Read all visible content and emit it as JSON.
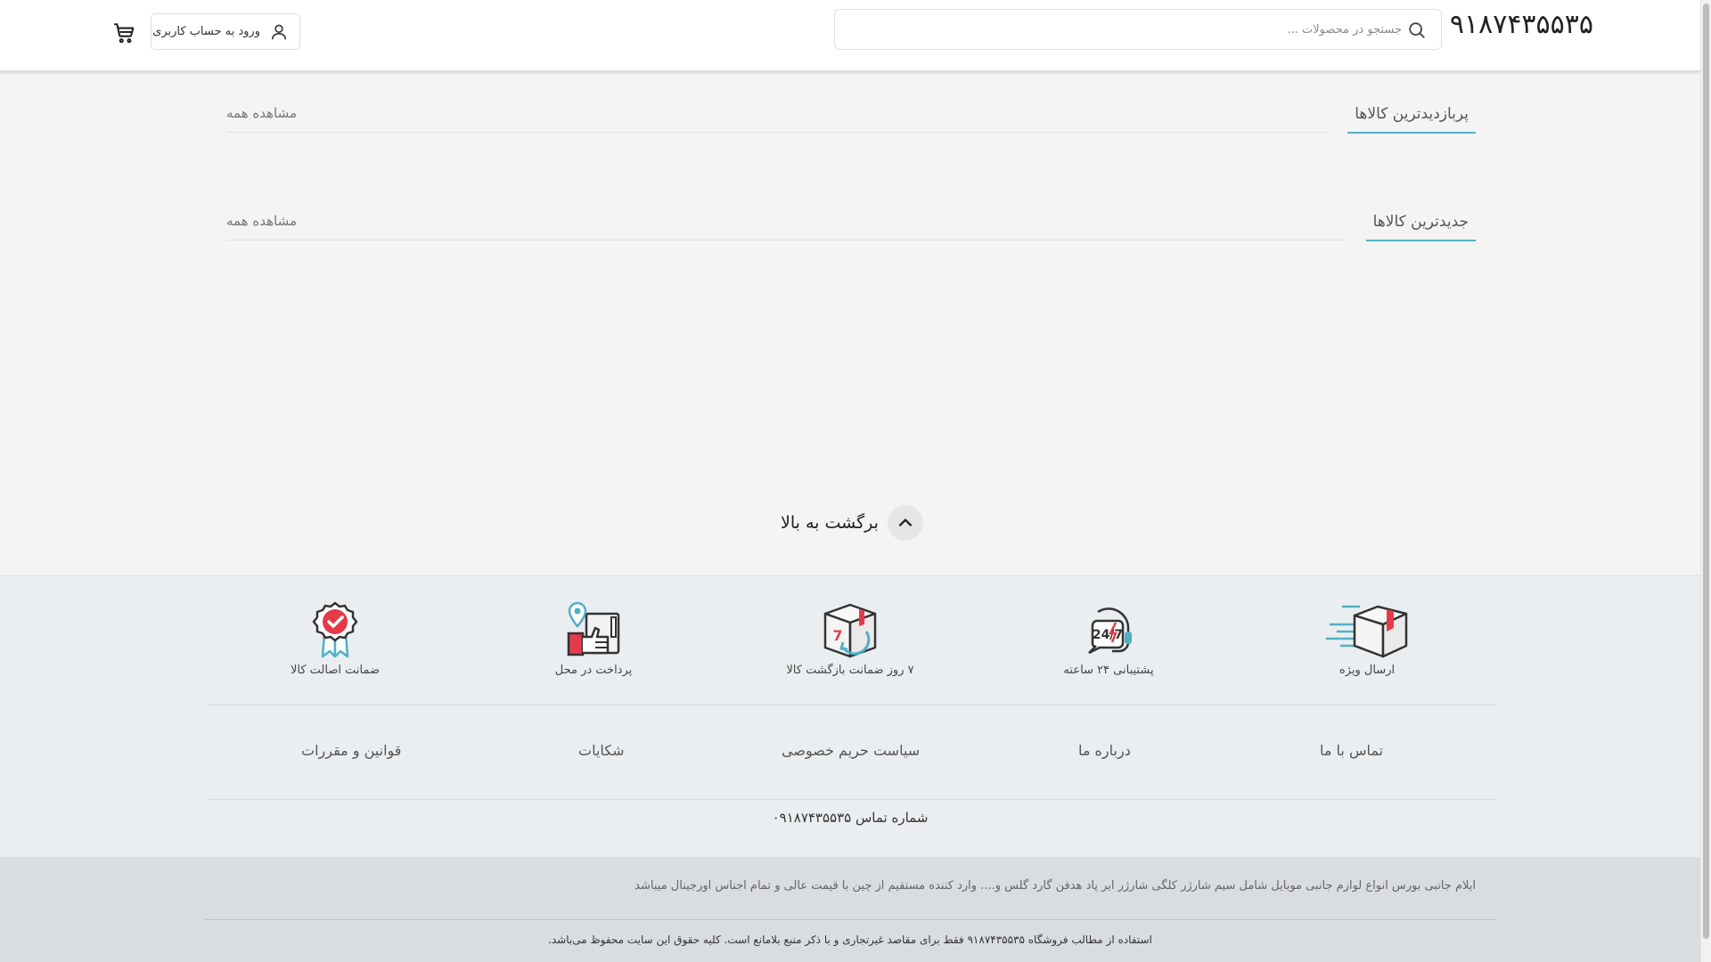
{
  "header": {
    "logo": "۹۱۸۷۴۳۵۵۳۵",
    "search_placeholder": "جستجو در محصولات ...",
    "login_label": "ورود به حساب کاربری"
  },
  "sections": [
    {
      "title": "پربازدیدترین کالاها",
      "see_all": "مشاهده همه"
    },
    {
      "title": "جدیدترین کالاها",
      "see_all": "مشاهده همه"
    }
  ],
  "back_to_top": "برگشت به بالا",
  "features": [
    {
      "label": "ارسال ویژه",
      "icon": "fast-delivery-box-icon"
    },
    {
      "label": "پشتیبانی ۲۴ ساعته",
      "icon": "support-24-7-icon"
    },
    {
      "label": "۷ روز ضمانت بازگشت کالا",
      "icon": "return-7-day-box-icon"
    },
    {
      "label": "پرداخت در محل",
      "icon": "cash-on-delivery-icon"
    },
    {
      "label": "ضمانت اصالت کالا",
      "icon": "authenticity-badge-icon"
    }
  ],
  "footer_links": [
    "تماس با ما",
    "درباره ما",
    "سیاست حریم خصوصی",
    "شکایات",
    "قوانین و مقررات"
  ],
  "contact": "شماره تماس ۰۹۱۸۷۴۳۵۵۳۵",
  "about_text": "ایلام جانبی بورس انواع لوازم جانبی موبایل شامل سیم شارژر کلگی شارژر ایر پاد هدفن گارد گلس و.... وارد کننده مستقیم از چین با قیمت عالی و تمام اجناس اورجینال میباشد",
  "copyright": "استفاده از مطالب فروشگاه ۹۱۸۷۴۳۵۵۳۵ فقط برای مقاصد غیرتجاری و با ذکر منبع بلامانع است. کلیه حقوق این سایت محفوظ می‌باشد.",
  "colors": {
    "accent": "#4fb1c5",
    "icon_red": "#e53a4a",
    "footer_bg": "#ebeef1",
    "bottom_bg": "#d9dde1"
  }
}
